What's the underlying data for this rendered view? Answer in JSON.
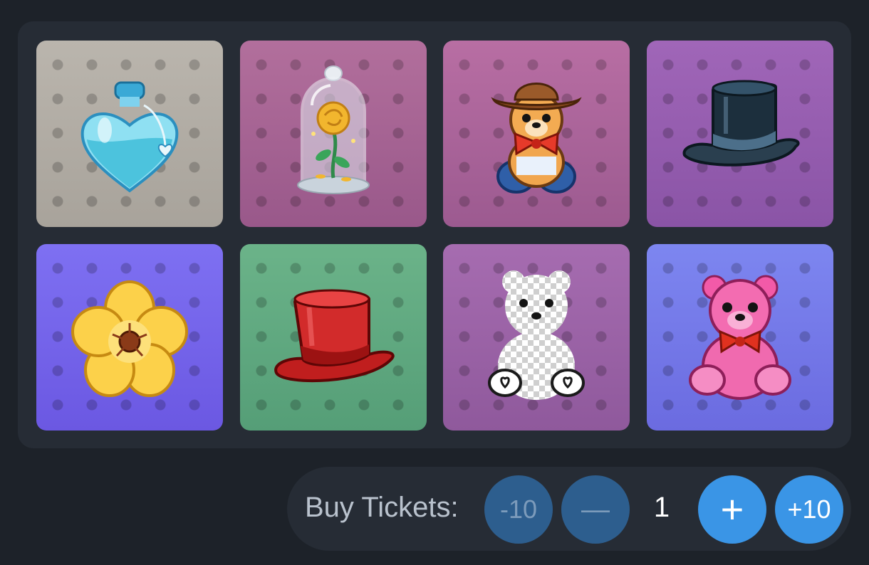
{
  "gifts": [
    {
      "name": "Love Potion",
      "bg_top": "#bab5ad",
      "bg_bottom": "#a8a39b"
    },
    {
      "name": "Eternal Rose",
      "bg_top": "#b26f9c",
      "bg_bottom": "#99588a"
    },
    {
      "name": "Cowboy Bear",
      "bg_top": "#b86ea3",
      "bg_bottom": "#9c5a90"
    },
    {
      "name": "Top Hat",
      "bg_top": "#a066b8",
      "bg_bottom": "#8a54a6"
    },
    {
      "name": "Flower",
      "bg_top": "#7e70f2",
      "bg_bottom": "#6b58e2"
    },
    {
      "name": "Red Top Hat",
      "bg_top": "#6bb389",
      "bg_bottom": "#559e77"
    },
    {
      "name": "Transparent Bear",
      "bg_top": "#a66cb0",
      "bg_bottom": "#8f599c"
    },
    {
      "name": "Pink Bear",
      "bg_top": "#7d86f0",
      "bg_bottom": "#6b6be0"
    }
  ],
  "buy": {
    "label": "Buy Tickets:",
    "minus_ten": "-10",
    "minus": "—",
    "quantity": "1",
    "plus": "+",
    "plus_ten": "+10"
  },
  "colors": {
    "page_bg": "#1d2229",
    "panel_bg": "#262c35",
    "button_dim": "#2d5e8e",
    "button_active": "#3a95e6"
  }
}
